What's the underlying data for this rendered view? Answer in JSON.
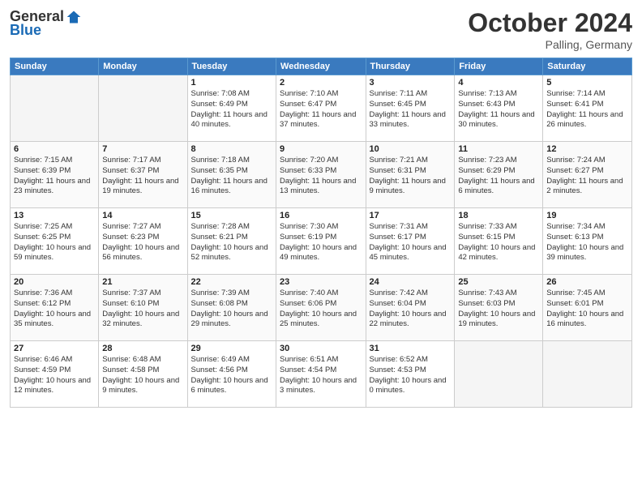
{
  "header": {
    "logo_general": "General",
    "logo_blue": "Blue",
    "month_title": "October 2024",
    "location": "Palling, Germany"
  },
  "weekdays": [
    "Sunday",
    "Monday",
    "Tuesday",
    "Wednesday",
    "Thursday",
    "Friday",
    "Saturday"
  ],
  "rows": [
    [
      {
        "day": "",
        "empty": true
      },
      {
        "day": "",
        "empty": true
      },
      {
        "day": "1",
        "sunrise": "Sunrise: 7:08 AM",
        "sunset": "Sunset: 6:49 PM",
        "daylight": "Daylight: 11 hours and 40 minutes."
      },
      {
        "day": "2",
        "sunrise": "Sunrise: 7:10 AM",
        "sunset": "Sunset: 6:47 PM",
        "daylight": "Daylight: 11 hours and 37 minutes."
      },
      {
        "day": "3",
        "sunrise": "Sunrise: 7:11 AM",
        "sunset": "Sunset: 6:45 PM",
        "daylight": "Daylight: 11 hours and 33 minutes."
      },
      {
        "day": "4",
        "sunrise": "Sunrise: 7:13 AM",
        "sunset": "Sunset: 6:43 PM",
        "daylight": "Daylight: 11 hours and 30 minutes."
      },
      {
        "day": "5",
        "sunrise": "Sunrise: 7:14 AM",
        "sunset": "Sunset: 6:41 PM",
        "daylight": "Daylight: 11 hours and 26 minutes."
      }
    ],
    [
      {
        "day": "6",
        "sunrise": "Sunrise: 7:15 AM",
        "sunset": "Sunset: 6:39 PM",
        "daylight": "Daylight: 11 hours and 23 minutes."
      },
      {
        "day": "7",
        "sunrise": "Sunrise: 7:17 AM",
        "sunset": "Sunset: 6:37 PM",
        "daylight": "Daylight: 11 hours and 19 minutes."
      },
      {
        "day": "8",
        "sunrise": "Sunrise: 7:18 AM",
        "sunset": "Sunset: 6:35 PM",
        "daylight": "Daylight: 11 hours and 16 minutes."
      },
      {
        "day": "9",
        "sunrise": "Sunrise: 7:20 AM",
        "sunset": "Sunset: 6:33 PM",
        "daylight": "Daylight: 11 hours and 13 minutes."
      },
      {
        "day": "10",
        "sunrise": "Sunrise: 7:21 AM",
        "sunset": "Sunset: 6:31 PM",
        "daylight": "Daylight: 11 hours and 9 minutes."
      },
      {
        "day": "11",
        "sunrise": "Sunrise: 7:23 AM",
        "sunset": "Sunset: 6:29 PM",
        "daylight": "Daylight: 11 hours and 6 minutes."
      },
      {
        "day": "12",
        "sunrise": "Sunrise: 7:24 AM",
        "sunset": "Sunset: 6:27 PM",
        "daylight": "Daylight: 11 hours and 2 minutes."
      }
    ],
    [
      {
        "day": "13",
        "sunrise": "Sunrise: 7:25 AM",
        "sunset": "Sunset: 6:25 PM",
        "daylight": "Daylight: 10 hours and 59 minutes."
      },
      {
        "day": "14",
        "sunrise": "Sunrise: 7:27 AM",
        "sunset": "Sunset: 6:23 PM",
        "daylight": "Daylight: 10 hours and 56 minutes."
      },
      {
        "day": "15",
        "sunrise": "Sunrise: 7:28 AM",
        "sunset": "Sunset: 6:21 PM",
        "daylight": "Daylight: 10 hours and 52 minutes."
      },
      {
        "day": "16",
        "sunrise": "Sunrise: 7:30 AM",
        "sunset": "Sunset: 6:19 PM",
        "daylight": "Daylight: 10 hours and 49 minutes."
      },
      {
        "day": "17",
        "sunrise": "Sunrise: 7:31 AM",
        "sunset": "Sunset: 6:17 PM",
        "daylight": "Daylight: 10 hours and 45 minutes."
      },
      {
        "day": "18",
        "sunrise": "Sunrise: 7:33 AM",
        "sunset": "Sunset: 6:15 PM",
        "daylight": "Daylight: 10 hours and 42 minutes."
      },
      {
        "day": "19",
        "sunrise": "Sunrise: 7:34 AM",
        "sunset": "Sunset: 6:13 PM",
        "daylight": "Daylight: 10 hours and 39 minutes."
      }
    ],
    [
      {
        "day": "20",
        "sunrise": "Sunrise: 7:36 AM",
        "sunset": "Sunset: 6:12 PM",
        "daylight": "Daylight: 10 hours and 35 minutes."
      },
      {
        "day": "21",
        "sunrise": "Sunrise: 7:37 AM",
        "sunset": "Sunset: 6:10 PM",
        "daylight": "Daylight: 10 hours and 32 minutes."
      },
      {
        "day": "22",
        "sunrise": "Sunrise: 7:39 AM",
        "sunset": "Sunset: 6:08 PM",
        "daylight": "Daylight: 10 hours and 29 minutes."
      },
      {
        "day": "23",
        "sunrise": "Sunrise: 7:40 AM",
        "sunset": "Sunset: 6:06 PM",
        "daylight": "Daylight: 10 hours and 25 minutes."
      },
      {
        "day": "24",
        "sunrise": "Sunrise: 7:42 AM",
        "sunset": "Sunset: 6:04 PM",
        "daylight": "Daylight: 10 hours and 22 minutes."
      },
      {
        "day": "25",
        "sunrise": "Sunrise: 7:43 AM",
        "sunset": "Sunset: 6:03 PM",
        "daylight": "Daylight: 10 hours and 19 minutes."
      },
      {
        "day": "26",
        "sunrise": "Sunrise: 7:45 AM",
        "sunset": "Sunset: 6:01 PM",
        "daylight": "Daylight: 10 hours and 16 minutes."
      }
    ],
    [
      {
        "day": "27",
        "sunrise": "Sunrise: 6:46 AM",
        "sunset": "Sunset: 4:59 PM",
        "daylight": "Daylight: 10 hours and 12 minutes."
      },
      {
        "day": "28",
        "sunrise": "Sunrise: 6:48 AM",
        "sunset": "Sunset: 4:58 PM",
        "daylight": "Daylight: 10 hours and 9 minutes."
      },
      {
        "day": "29",
        "sunrise": "Sunrise: 6:49 AM",
        "sunset": "Sunset: 4:56 PM",
        "daylight": "Daylight: 10 hours and 6 minutes."
      },
      {
        "day": "30",
        "sunrise": "Sunrise: 6:51 AM",
        "sunset": "Sunset: 4:54 PM",
        "daylight": "Daylight: 10 hours and 3 minutes."
      },
      {
        "day": "31",
        "sunrise": "Sunrise: 6:52 AM",
        "sunset": "Sunset: 4:53 PM",
        "daylight": "Daylight: 10 hours and 0 minutes."
      },
      {
        "day": "",
        "empty": true
      },
      {
        "day": "",
        "empty": true
      }
    ]
  ]
}
